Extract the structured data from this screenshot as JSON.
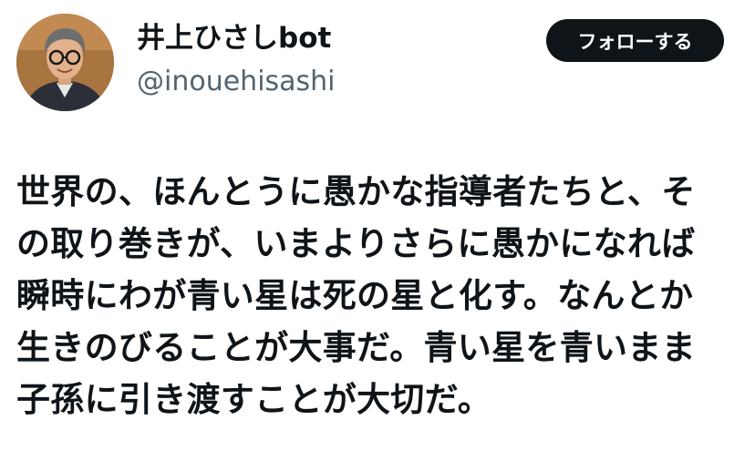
{
  "author": {
    "name": "井上ひさしbot",
    "handle": "@inouehisashi",
    "avatar_icon": "profile-photo"
  },
  "follow_button": {
    "label": "フォローする"
  },
  "tweet": {
    "lines": [
      "世界の、ほんとうに愚かな指導者たちと、そ",
      "の取り巻きが、いまよりさらに愚かになれば",
      "瞬時にわが青い星は死の星と化す。なんとか",
      "生きのびることが大事だ。青い星を青いまま",
      "子孫に引き渡すことが大切だ。"
    ]
  },
  "colors": {
    "text": "#0f1419",
    "handle": "#536471",
    "button_bg": "#0f1419",
    "button_text": "#ffffff",
    "background": "#ffffff"
  }
}
